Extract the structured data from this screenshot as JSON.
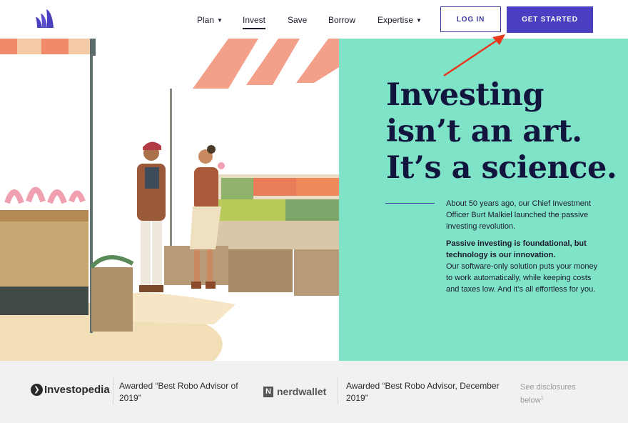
{
  "header": {
    "logo": "wealthfront-logo-icon",
    "nav": [
      {
        "label": "Plan",
        "has_dropdown": true
      },
      {
        "label": "Invest",
        "has_dropdown": false,
        "active": true
      },
      {
        "label": "Save",
        "has_dropdown": false
      },
      {
        "label": "Borrow",
        "has_dropdown": false
      },
      {
        "label": "Expertise",
        "has_dropdown": true
      }
    ],
    "login_label": "LOG IN",
    "start_label": "GET STARTED"
  },
  "hero": {
    "headline": [
      "Investing",
      "isn’t an art.",
      "It’s a science."
    ],
    "para1": "About 50 years ago, our Chief Investment Officer Burt Malkiel launched the passive investing revolution.",
    "para2_bold": "Passive investing is foundational, but technology is our innovation.",
    "para2_rest": "Our software-only solution puts your money to work automatically, while keeping costs and taxes low. And it’s all effortless for you."
  },
  "awards": {
    "investopedia_name": "Investopedia",
    "investopedia_award": "Awarded “Best Robo Advisor of 2019”",
    "nerdwallet_name": "nerdwallet",
    "nerdwallet_award": "Awarded “Best Robo Advisor, December 2019”",
    "disclosure": "See disclosures below",
    "disclosure_ref": "1"
  },
  "colors": {
    "accent": "#4a3fc0",
    "hero_panel": "#7fe3c8",
    "headline": "#12163f",
    "annotation": "#e8391d"
  }
}
